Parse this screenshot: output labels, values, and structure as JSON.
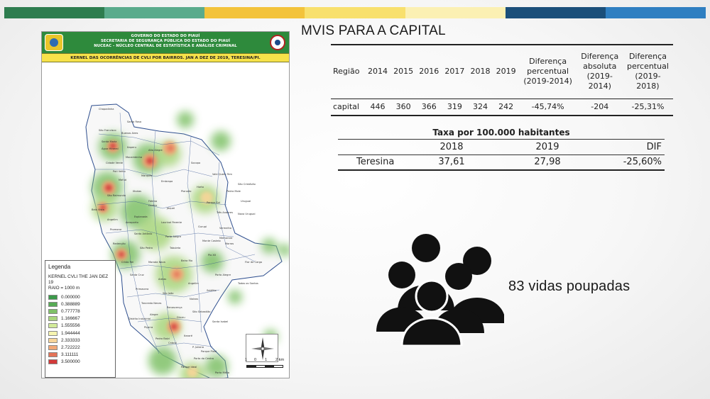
{
  "top_band_colors": [
    "#2e7d4f",
    "#5aab8c",
    "#f3c33b",
    "#f8e06d",
    "#fbf0b3",
    "#1b4f7a",
    "#2f7fc1"
  ],
  "map": {
    "header_line1": "GOVERNO DO ESTADO DO PIAUÍ",
    "header_line2": "SECRETARIA DE SEGURANÇA PÚBLICA DO ESTADO DO PIAUÍ",
    "header_line3": "NUCEAC - NÚCLEO CENTRAL DE ESTATÍSTICA E ANÁLISE CRIMINAL",
    "subtitle": "KERNEL DAS OCORRÊNCIAS DE CVLI POR BAIRROS. JAN A DEZ DE 2019, TERESINA/PI.",
    "legend": {
      "title": "Legenda",
      "layer": "KERNEL CVLI THE JAN DEZ 19",
      "radius": "RAIO = 1000 m",
      "entries": [
        {
          "value": "0.000000",
          "color": "#3b9a4a"
        },
        {
          "value": "0.388889",
          "color": "#57ab55"
        },
        {
          "value": "0.777778",
          "color": "#7fc168"
        },
        {
          "value": "1.166667",
          "color": "#a9d67d"
        },
        {
          "value": "1.555556",
          "color": "#d3eb9a"
        },
        {
          "value": "1.944444",
          "color": "#f6f4b0"
        },
        {
          "value": "2.333333",
          "color": "#f8d59a"
        },
        {
          "value": "2.722222",
          "color": "#f2a877"
        },
        {
          "value": "3.111111",
          "color": "#e47358"
        },
        {
          "value": "3.500000",
          "color": "#d33a3a"
        }
      ]
    },
    "scale_labels": [
      "1",
      "0",
      "1",
      "2 km"
    ],
    "neighborhoods": [
      {
        "label": "Chapadinha"
      },
      {
        "label": "Santa Rosa"
      },
      {
        "label": "São Francisco"
      },
      {
        "label": "Buenos Aires"
      },
      {
        "label": "Santa Maria"
      },
      {
        "label": "Itaperu"
      },
      {
        "label": "Mocambinho"
      },
      {
        "label": "Cidade Verde"
      },
      {
        "label": "Poti Velho"
      },
      {
        "label": "Alto Alegre"
      },
      {
        "label": "Mafuá"
      },
      {
        "label": "Marquês"
      },
      {
        "label": "Embrapa"
      },
      {
        "label": "Socopo"
      },
      {
        "label": "Planalto"
      },
      {
        "label": "Vale Quem Tem"
      },
      {
        "label": "São Raimundo"
      },
      {
        "label": "Ilhotas"
      },
      {
        "label": "Fátima"
      },
      {
        "label": "Jóquei"
      },
      {
        "label": "Horto"
      },
      {
        "label": "Bela Vista"
      },
      {
        "label": "Angelim"
      },
      {
        "label": "Esplanada"
      },
      {
        "label": "Lourival Parente"
      },
      {
        "label": "Parque Sul"
      },
      {
        "label": "Três Andares"
      },
      {
        "label": "Promorar"
      },
      {
        "label": "Santo Antônio"
      },
      {
        "label": "Porto Alegre"
      },
      {
        "label": "Gurupi"
      },
      {
        "label": "Vermelha"
      },
      {
        "label": "Redenção"
      },
      {
        "label": "São Pedro"
      },
      {
        "label": "Tabuleta"
      },
      {
        "label": "Monte Castelo"
      },
      {
        "label": "Cristo Rei"
      },
      {
        "label": "Morada Nova"
      },
      {
        "label": "Beira Rio"
      },
      {
        "label": "Pio XII"
      },
      {
        "label": "Santa Cruz"
      },
      {
        "label": "Areias"
      },
      {
        "label": "Angelim"
      },
      {
        "label": "Porto Alegre"
      },
      {
        "label": "P. Juliana"
      },
      {
        "label": "São Cristóvão"
      },
      {
        "label": "Uruguai"
      },
      {
        "label": "Pedra Mole"
      },
      {
        "label": "Novo Uruguai"
      },
      {
        "label": "Primavera"
      },
      {
        "label": "São João"
      },
      {
        "label": "Noivos"
      },
      {
        "label": "Satélite"
      },
      {
        "label": "Morros"
      },
      {
        "label": "Tancredo Neves"
      },
      {
        "label": "Renascença"
      },
      {
        "label": "São Sebastião"
      },
      {
        "label": "Flor de Cargo"
      },
      {
        "label": "Alegre"
      },
      {
        "label": "Dirceu"
      },
      {
        "label": "Itararé"
      },
      {
        "label": "Pedro Balzi"
      },
      {
        "label": "Santa Isabel"
      },
      {
        "label": "Todos os Santos"
      },
      {
        "label": "Piçarra"
      },
      {
        "label": "Cabral"
      },
      {
        "label": "Centro"
      },
      {
        "label": "Aeroporto"
      },
      {
        "label": "Água Mineral"
      },
      {
        "label": "Memorare"
      },
      {
        "label": "Parque Piauí"
      },
      {
        "label": "Distrito Industrial"
      },
      {
        "label": "Porto do Centro"
      },
      {
        "label": "Parque Ideal"
      },
      {
        "label": "Porto Mélia"
      }
    ]
  },
  "title": "MVIS PARA A CAPITAL",
  "table1": {
    "headers": [
      "Região",
      "2014",
      "2015",
      "2016",
      "2017",
      "2018",
      "2019",
      [
        "Diferença",
        "percentual",
        "(2019-2014)"
      ],
      [
        "Diferença",
        "absoluta",
        "(2019-",
        "2014)"
      ],
      [
        "Diferença",
        "percentual",
        "(2019-",
        "2018)"
      ]
    ],
    "row": [
      "capital",
      "446",
      "360",
      "366",
      "319",
      "324",
      "242",
      "-45,74%",
      "-204",
      "-25,31%"
    ]
  },
  "table2": {
    "title": "Taxa por 100.000 habitantes",
    "headers": [
      "",
      "2018",
      "2019",
      "DIF"
    ],
    "row": [
      "Teresina",
      "37,61",
      "27,98",
      "-25,60%"
    ]
  },
  "people_icon": "people-group-icon",
  "lives_text": "83 vidas poupadas"
}
